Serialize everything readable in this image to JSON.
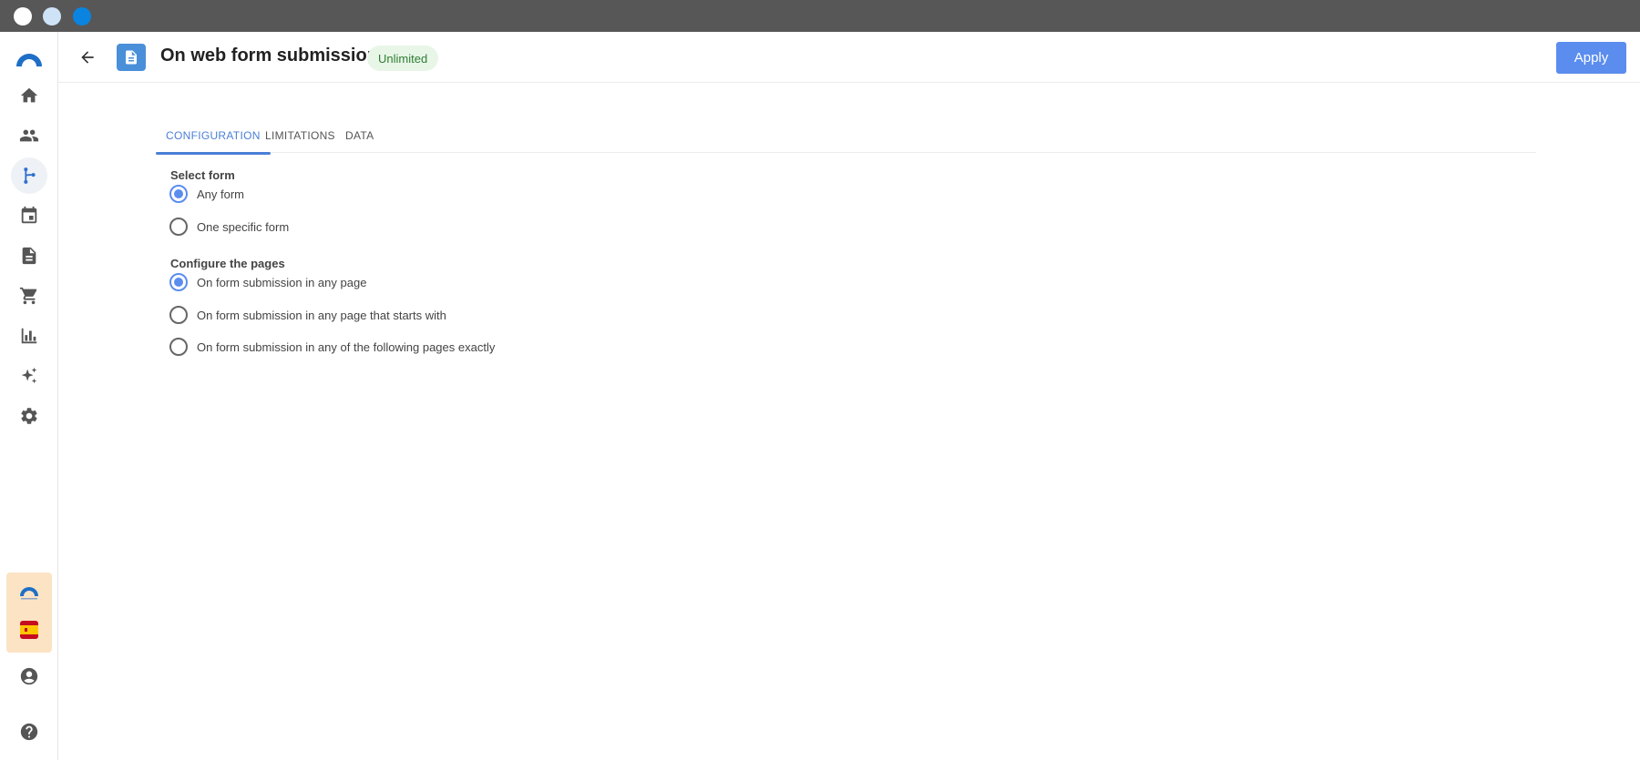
{
  "window": {
    "controls": [
      "close",
      "minimize",
      "maximize"
    ]
  },
  "sidebar": {
    "items": [
      {
        "icon": "home-icon",
        "active": false
      },
      {
        "icon": "people-icon",
        "active": false
      },
      {
        "icon": "flow-branch-icon",
        "active": true
      },
      {
        "icon": "calendar-icon",
        "active": false
      },
      {
        "icon": "document-icon",
        "active": false
      },
      {
        "icon": "cart-icon",
        "active": false
      },
      {
        "icon": "bar-chart-icon",
        "active": false
      },
      {
        "icon": "sparkle-icon",
        "active": false
      },
      {
        "icon": "gear-icon",
        "active": false
      }
    ],
    "bottom": [
      "account-icon",
      "help-icon"
    ]
  },
  "header": {
    "title": "On web form submission",
    "badge": "Unlimited",
    "apply_label": "Apply"
  },
  "tabs": [
    {
      "label": "CONFIGURATION",
      "active": true
    },
    {
      "label": "LIMITATIONS",
      "active": false
    },
    {
      "label": "DATA",
      "active": false
    }
  ],
  "select_form": {
    "label": "Select form",
    "options": [
      {
        "label": "Any form",
        "checked": true
      },
      {
        "label": "One specific form",
        "checked": false
      }
    ]
  },
  "configure_pages": {
    "label": "Configure the pages",
    "options": [
      {
        "label": "On form submission in any page",
        "checked": true
      },
      {
        "label": "On form submission in any page that starts with",
        "checked": false
      },
      {
        "label": "On form submission in any of the following pages exactly",
        "checked": false
      }
    ]
  },
  "colors": {
    "accent": "#5b8def",
    "brand": "#1f6fc6",
    "badge_bg": "#e8f6e8",
    "badge_text": "#2e7d32"
  }
}
